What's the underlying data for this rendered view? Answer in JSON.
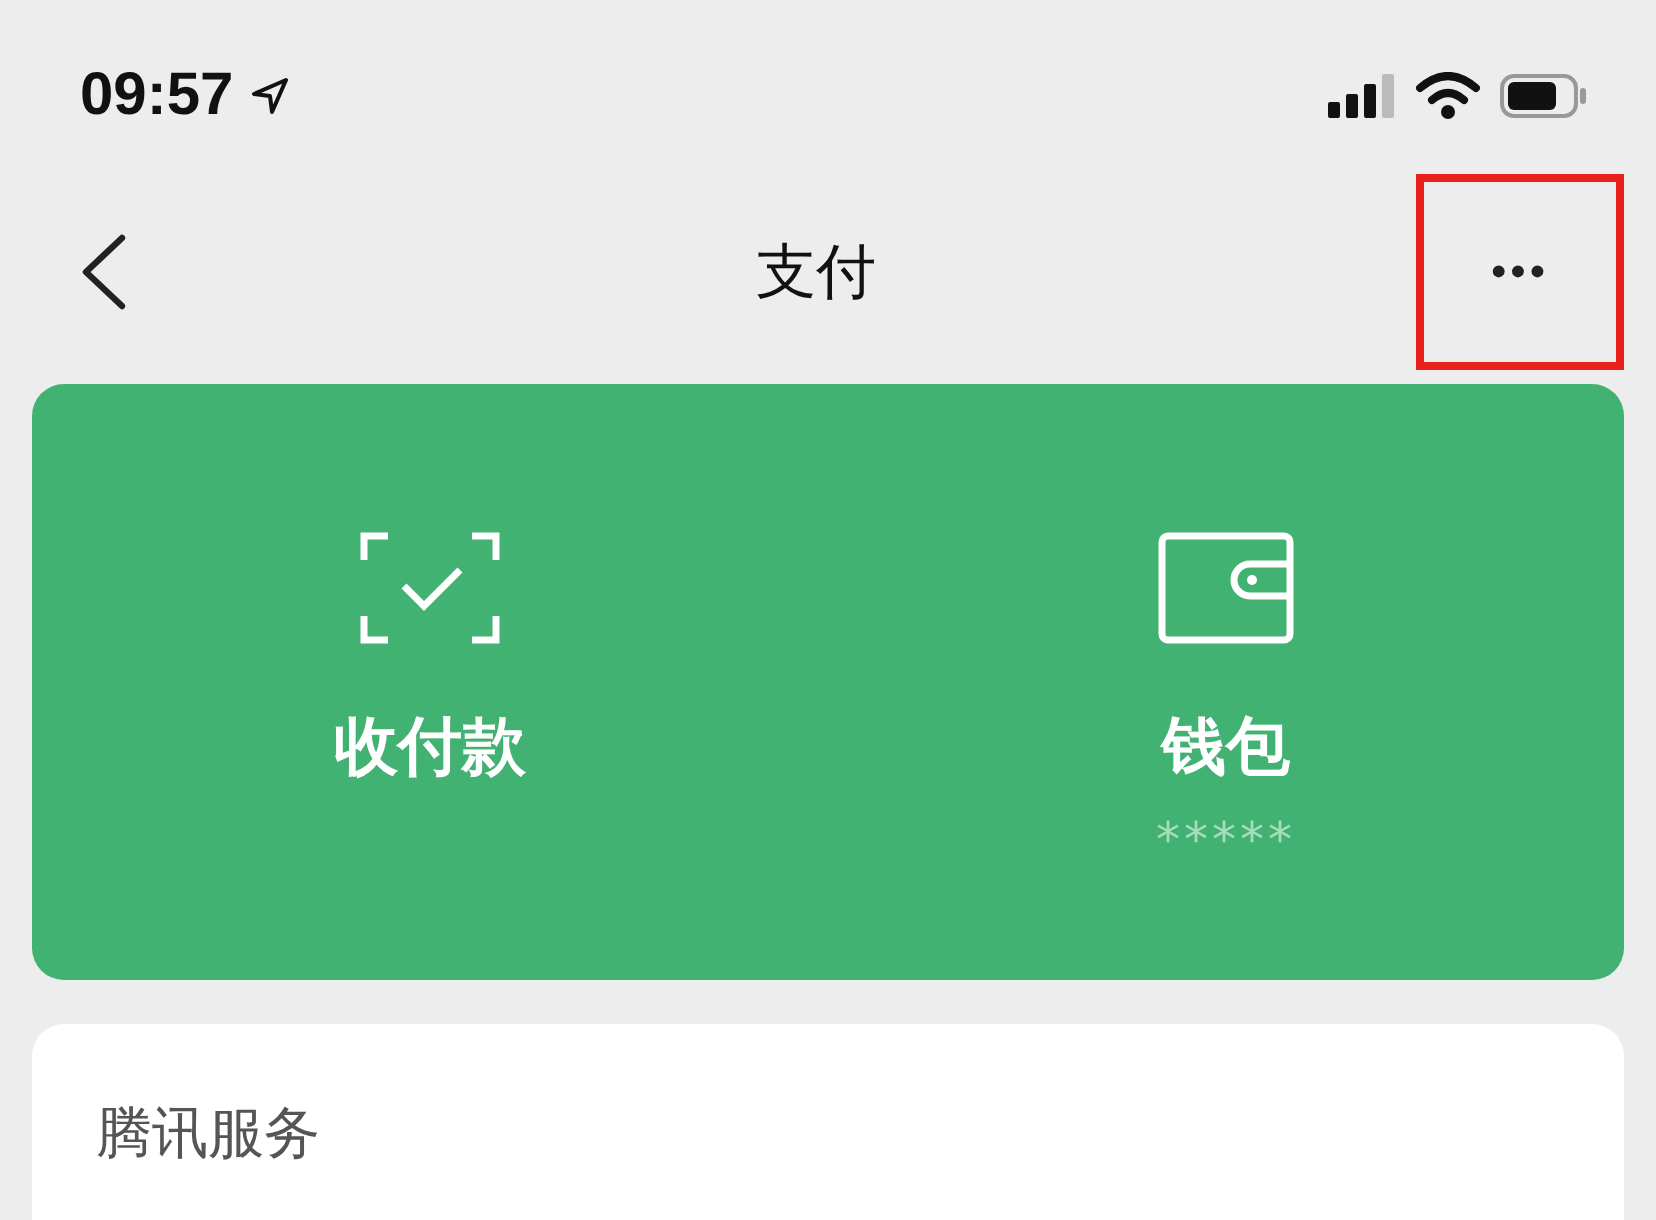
{
  "status_bar": {
    "time": "09:57"
  },
  "nav": {
    "title": "支付",
    "more_button": {
      "label": "•••",
      "highlighted": true
    }
  },
  "payment_card": {
    "items": [
      {
        "kind": "scan",
        "label": "收付款"
      },
      {
        "kind": "wallet",
        "label": "钱包",
        "balance": "*****"
      }
    ]
  },
  "services_card": {
    "title": "腾讯服务"
  }
}
